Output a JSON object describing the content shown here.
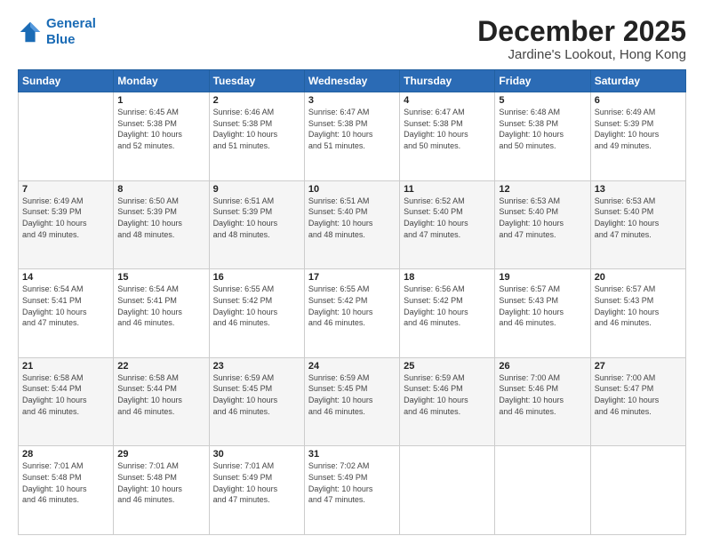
{
  "header": {
    "logo_line1": "General",
    "logo_line2": "Blue",
    "month_title": "December 2025",
    "location": "Jardine's Lookout, Hong Kong"
  },
  "weekdays": [
    "Sunday",
    "Monday",
    "Tuesday",
    "Wednesday",
    "Thursday",
    "Friday",
    "Saturday"
  ],
  "weeks": [
    [
      {
        "day": "",
        "info": ""
      },
      {
        "day": "1",
        "info": "Sunrise: 6:45 AM\nSunset: 5:38 PM\nDaylight: 10 hours\nand 52 minutes."
      },
      {
        "day": "2",
        "info": "Sunrise: 6:46 AM\nSunset: 5:38 PM\nDaylight: 10 hours\nand 51 minutes."
      },
      {
        "day": "3",
        "info": "Sunrise: 6:47 AM\nSunset: 5:38 PM\nDaylight: 10 hours\nand 51 minutes."
      },
      {
        "day": "4",
        "info": "Sunrise: 6:47 AM\nSunset: 5:38 PM\nDaylight: 10 hours\nand 50 minutes."
      },
      {
        "day": "5",
        "info": "Sunrise: 6:48 AM\nSunset: 5:38 PM\nDaylight: 10 hours\nand 50 minutes."
      },
      {
        "day": "6",
        "info": "Sunrise: 6:49 AM\nSunset: 5:39 PM\nDaylight: 10 hours\nand 49 minutes."
      }
    ],
    [
      {
        "day": "7",
        "info": "Sunrise: 6:49 AM\nSunset: 5:39 PM\nDaylight: 10 hours\nand 49 minutes."
      },
      {
        "day": "8",
        "info": "Sunrise: 6:50 AM\nSunset: 5:39 PM\nDaylight: 10 hours\nand 48 minutes."
      },
      {
        "day": "9",
        "info": "Sunrise: 6:51 AM\nSunset: 5:39 PM\nDaylight: 10 hours\nand 48 minutes."
      },
      {
        "day": "10",
        "info": "Sunrise: 6:51 AM\nSunset: 5:40 PM\nDaylight: 10 hours\nand 48 minutes."
      },
      {
        "day": "11",
        "info": "Sunrise: 6:52 AM\nSunset: 5:40 PM\nDaylight: 10 hours\nand 47 minutes."
      },
      {
        "day": "12",
        "info": "Sunrise: 6:53 AM\nSunset: 5:40 PM\nDaylight: 10 hours\nand 47 minutes."
      },
      {
        "day": "13",
        "info": "Sunrise: 6:53 AM\nSunset: 5:40 PM\nDaylight: 10 hours\nand 47 minutes."
      }
    ],
    [
      {
        "day": "14",
        "info": "Sunrise: 6:54 AM\nSunset: 5:41 PM\nDaylight: 10 hours\nand 47 minutes."
      },
      {
        "day": "15",
        "info": "Sunrise: 6:54 AM\nSunset: 5:41 PM\nDaylight: 10 hours\nand 46 minutes."
      },
      {
        "day": "16",
        "info": "Sunrise: 6:55 AM\nSunset: 5:42 PM\nDaylight: 10 hours\nand 46 minutes."
      },
      {
        "day": "17",
        "info": "Sunrise: 6:55 AM\nSunset: 5:42 PM\nDaylight: 10 hours\nand 46 minutes."
      },
      {
        "day": "18",
        "info": "Sunrise: 6:56 AM\nSunset: 5:42 PM\nDaylight: 10 hours\nand 46 minutes."
      },
      {
        "day": "19",
        "info": "Sunrise: 6:57 AM\nSunset: 5:43 PM\nDaylight: 10 hours\nand 46 minutes."
      },
      {
        "day": "20",
        "info": "Sunrise: 6:57 AM\nSunset: 5:43 PM\nDaylight: 10 hours\nand 46 minutes."
      }
    ],
    [
      {
        "day": "21",
        "info": "Sunrise: 6:58 AM\nSunset: 5:44 PM\nDaylight: 10 hours\nand 46 minutes."
      },
      {
        "day": "22",
        "info": "Sunrise: 6:58 AM\nSunset: 5:44 PM\nDaylight: 10 hours\nand 46 minutes."
      },
      {
        "day": "23",
        "info": "Sunrise: 6:59 AM\nSunset: 5:45 PM\nDaylight: 10 hours\nand 46 minutes."
      },
      {
        "day": "24",
        "info": "Sunrise: 6:59 AM\nSunset: 5:45 PM\nDaylight: 10 hours\nand 46 minutes."
      },
      {
        "day": "25",
        "info": "Sunrise: 6:59 AM\nSunset: 5:46 PM\nDaylight: 10 hours\nand 46 minutes."
      },
      {
        "day": "26",
        "info": "Sunrise: 7:00 AM\nSunset: 5:46 PM\nDaylight: 10 hours\nand 46 minutes."
      },
      {
        "day": "27",
        "info": "Sunrise: 7:00 AM\nSunset: 5:47 PM\nDaylight: 10 hours\nand 46 minutes."
      }
    ],
    [
      {
        "day": "28",
        "info": "Sunrise: 7:01 AM\nSunset: 5:48 PM\nDaylight: 10 hours\nand 46 minutes."
      },
      {
        "day": "29",
        "info": "Sunrise: 7:01 AM\nSunset: 5:48 PM\nDaylight: 10 hours\nand 46 minutes."
      },
      {
        "day": "30",
        "info": "Sunrise: 7:01 AM\nSunset: 5:49 PM\nDaylight: 10 hours\nand 47 minutes."
      },
      {
        "day": "31",
        "info": "Sunrise: 7:02 AM\nSunset: 5:49 PM\nDaylight: 10 hours\nand 47 minutes."
      },
      {
        "day": "",
        "info": ""
      },
      {
        "day": "",
        "info": ""
      },
      {
        "day": "",
        "info": ""
      }
    ]
  ]
}
